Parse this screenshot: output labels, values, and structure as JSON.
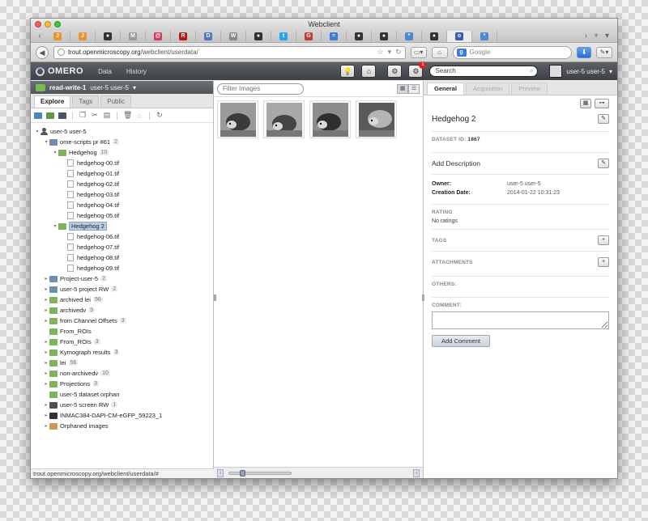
{
  "window": {
    "title": "Webclient"
  },
  "browser": {
    "url_host": "trout.openmicroscopy.org",
    "url_path": "/webclient/userdata/",
    "search_placeholder": "Google",
    "favtabs": [
      {
        "icon": "J",
        "color": "#e8952f"
      },
      {
        "icon": "J",
        "color": "#e8952f"
      },
      {
        "icon": "gh",
        "color": "#333333"
      },
      {
        "icon": "M",
        "color": "#9a9a9a"
      },
      {
        "icon": "@",
        "color": "#d03a5c"
      },
      {
        "icon": "R",
        "color": "#b31b1b"
      },
      {
        "icon": "D",
        "color": "#4f7ac2"
      },
      {
        "icon": "W",
        "color": "#888888"
      },
      {
        "icon": "gh",
        "color": "#333333"
      },
      {
        "icon": "t",
        "color": "#2aa3ef"
      },
      {
        "icon": "G",
        "color": "#c23b3b"
      },
      {
        "icon": "=",
        "color": "#3b7ddd"
      },
      {
        "icon": "gh",
        "color": "#333333"
      },
      {
        "icon": "gh",
        "color": "#333333"
      },
      {
        "icon": "*",
        "color": "#4a8ad0"
      },
      {
        "icon": "gh",
        "color": "#333333"
      },
      {
        "icon": "o",
        "color": "#3a5fa8"
      },
      {
        "icon": "*",
        "color": "#4a8ad0"
      }
    ]
  },
  "omero": {
    "logo": "OMERO",
    "menu": [
      "Data",
      "History"
    ],
    "notification_count": "1",
    "search_value": "Search",
    "user": "user-5 user-5"
  },
  "left": {
    "group_name": "read-write-1",
    "group_user": "user-5 user-5",
    "tabs": [
      "Explore",
      "Tags",
      "Public"
    ],
    "status_url": "trout.openmicroscopy.org/webclient/userdata/#",
    "tree": [
      {
        "depth": 0,
        "type": "user",
        "label": "user-5 user-5",
        "open": true
      },
      {
        "depth": 1,
        "type": "proj",
        "label": "ome-scripts pr #61",
        "count": "2",
        "open": true
      },
      {
        "depth": 2,
        "type": "ds",
        "label": "Hedgehog",
        "count": "10",
        "open": true
      },
      {
        "depth": 3,
        "type": "img",
        "label": "hedgehog-00.tif"
      },
      {
        "depth": 3,
        "type": "img",
        "label": "hedgehog-01.tif"
      },
      {
        "depth": 3,
        "type": "img",
        "label": "hedgehog-02.tif"
      },
      {
        "depth": 3,
        "type": "img",
        "label": "hedgehog-03.tif"
      },
      {
        "depth": 3,
        "type": "img",
        "label": "hedgehog-04.tif"
      },
      {
        "depth": 3,
        "type": "img",
        "label": "hedgehog-05.tif"
      },
      {
        "depth": 2,
        "type": "ds",
        "label": "Hedgehog 2",
        "open": true,
        "selected": true
      },
      {
        "depth": 3,
        "type": "img",
        "label": "hedgehog-06.tif"
      },
      {
        "depth": 3,
        "type": "img",
        "label": "hedgehog-07.tif"
      },
      {
        "depth": 3,
        "type": "img",
        "label": "hedgehog-08.tif"
      },
      {
        "depth": 3,
        "type": "img",
        "label": "hedgehog-09.tif"
      },
      {
        "depth": 1,
        "type": "proj",
        "label": "Project-user-5",
        "count": "2",
        "open": false
      },
      {
        "depth": 1,
        "type": "proj",
        "label": "user-5 project RW",
        "count": "2",
        "open": false
      },
      {
        "depth": 1,
        "type": "ds",
        "label": "archived lei",
        "count": "56",
        "open": false
      },
      {
        "depth": 1,
        "type": "ds",
        "label": "archivedv",
        "count": "9",
        "open": false
      },
      {
        "depth": 1,
        "type": "ds",
        "label": "from Channel Offsets",
        "count": "3",
        "open": false
      },
      {
        "depth": 1,
        "type": "ds",
        "label": "From_ROIs",
        "leaf": true
      },
      {
        "depth": 1,
        "type": "ds",
        "label": "From_ROIs",
        "count": "3",
        "open": false
      },
      {
        "depth": 1,
        "type": "ds",
        "label": "Kymograph results",
        "count": "3",
        "open": false
      },
      {
        "depth": 1,
        "type": "ds",
        "label": "lei",
        "count": "56",
        "open": false
      },
      {
        "depth": 1,
        "type": "ds",
        "label": "non-archivedv",
        "count": "10",
        "open": false
      },
      {
        "depth": 1,
        "type": "ds",
        "label": "Projections",
        "count": "3",
        "open": false
      },
      {
        "depth": 1,
        "type": "ds",
        "label": "user-5 dataset orphan",
        "leaf": true
      },
      {
        "depth": 1,
        "type": "screen",
        "label": "user-5 screen RW",
        "count": "1",
        "open": false
      },
      {
        "depth": 1,
        "type": "plate",
        "label": "INMAC384-DAPI-CM-eGFP_59223_1",
        "open": false
      },
      {
        "depth": 1,
        "type": "orphan",
        "label": "Orphaned images",
        "open": false
      }
    ]
  },
  "center": {
    "filter_placeholder": "Filter Images",
    "thumbnails": [
      "hedgehog-06.tif",
      "hedgehog-07.tif",
      "hedgehog-08.tif",
      "hedgehog-09.tif"
    ],
    "zoom_fraction": 0.18
  },
  "right": {
    "tabs": [
      "General",
      "Acquisition",
      "Preview"
    ],
    "title": "Hedgehog 2",
    "dataset_id_label": "DATASET ID:",
    "dataset_id": "1867",
    "add_description": "Add Description",
    "owner_label": "Owner:",
    "owner": "user-5 user-5",
    "creation_label": "Creation Date:",
    "creation_date": "2014-01-22 10:31:23",
    "rating_label": "RATING",
    "rating_value": "No ratings",
    "tags_label": "TAGS",
    "attachments_label": "ATTACHMENTS",
    "others_label": "OTHERS:",
    "comment_label": "COMMENT:",
    "add_comment": "Add Comment"
  }
}
